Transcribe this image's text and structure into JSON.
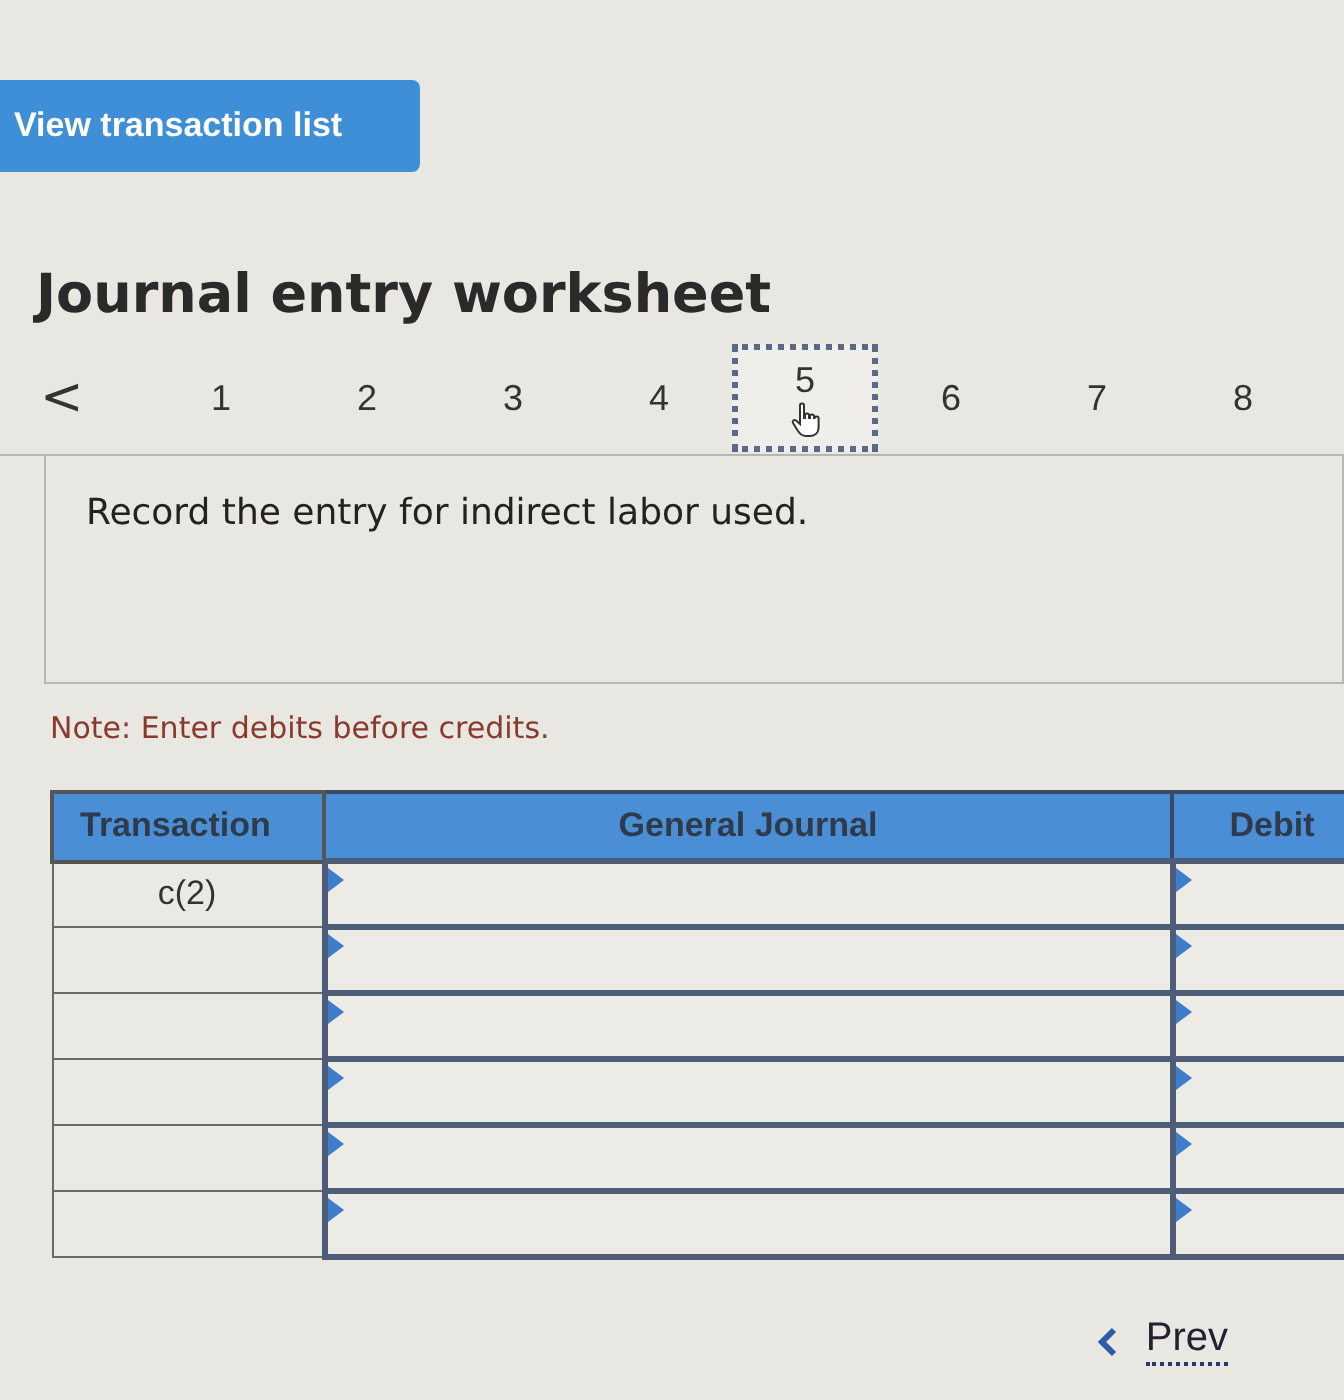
{
  "top_button": {
    "label": "View transaction list"
  },
  "title": "Journal entry worksheet",
  "steps": {
    "prev_icon": "<",
    "items": [
      {
        "label": "1",
        "selected": false
      },
      {
        "label": "2",
        "selected": false
      },
      {
        "label": "3",
        "selected": false
      },
      {
        "label": "4",
        "selected": false
      },
      {
        "label": "5",
        "selected": true
      },
      {
        "label": "6",
        "selected": false
      },
      {
        "label": "7",
        "selected": false
      },
      {
        "label": "8",
        "selected": false
      }
    ]
  },
  "prompt": "Record the entry for indirect labor used.",
  "note": "Note: Enter debits before credits.",
  "table": {
    "columns": [
      "Transaction",
      "General Journal",
      "Debit"
    ],
    "rows": [
      {
        "kind": "entry",
        "transaction": "c(2)"
      },
      {
        "kind": "blank"
      },
      {
        "kind": "blank"
      },
      {
        "kind": "blank"
      },
      {
        "kind": "blank"
      },
      {
        "kind": "blank"
      }
    ]
  },
  "pager": {
    "prev": "Prev"
  }
}
